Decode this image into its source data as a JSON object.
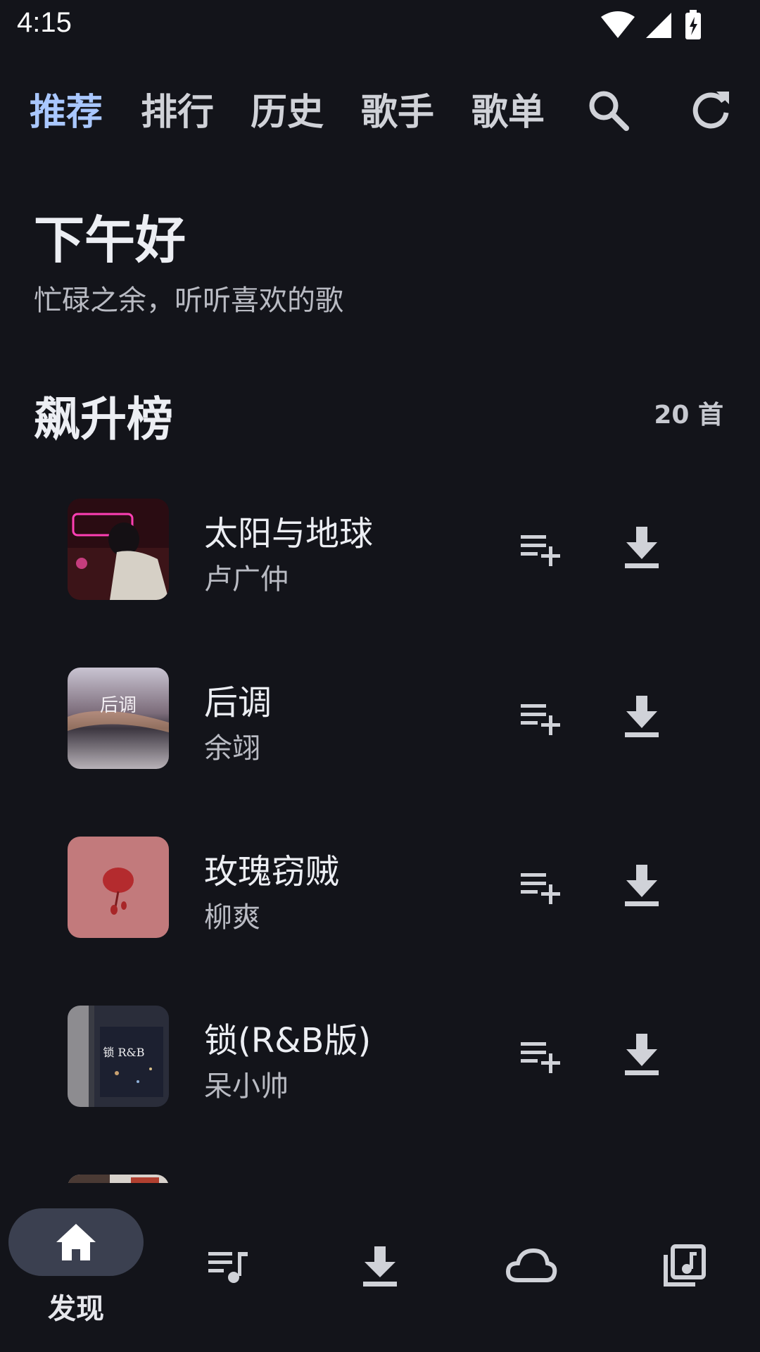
{
  "status": {
    "time": "4:15"
  },
  "tabs": [
    {
      "label": "推荐",
      "active": true
    },
    {
      "label": "排行",
      "active": false
    },
    {
      "label": "历史",
      "active": false
    },
    {
      "label": "歌手",
      "active": false
    },
    {
      "label": "歌单",
      "active": false
    }
  ],
  "icons": {
    "search": "search-icon",
    "refresh": "refresh-icon"
  },
  "greeting": {
    "title": "下午好",
    "subtitle": "忙碌之余，听听喜欢的歌"
  },
  "chart": {
    "title": "飙升榜",
    "count": "20 首"
  },
  "songs": [
    {
      "title": "太阳与地球",
      "artist": "卢广仲"
    },
    {
      "title": "后调",
      "artist": "余翊",
      "cover_text": "后调"
    },
    {
      "title": "玫瑰窃贼",
      "artist": "柳爽"
    },
    {
      "title": "锁(R&B版)",
      "artist": "呆小帅",
      "cover_text": "锁 R&B"
    },
    {
      "title": "",
      "artist": ""
    }
  ],
  "bottom_nav": [
    {
      "label": "发现",
      "icon": "home-icon",
      "active": true
    },
    {
      "icon": "playlist-icon"
    },
    {
      "icon": "download-icon"
    },
    {
      "icon": "cloud-icon"
    },
    {
      "icon": "library-music-icon"
    }
  ],
  "colors": {
    "background": "#13141a",
    "accent": "#a9c7ff",
    "nav_pill": "#3b4050"
  }
}
